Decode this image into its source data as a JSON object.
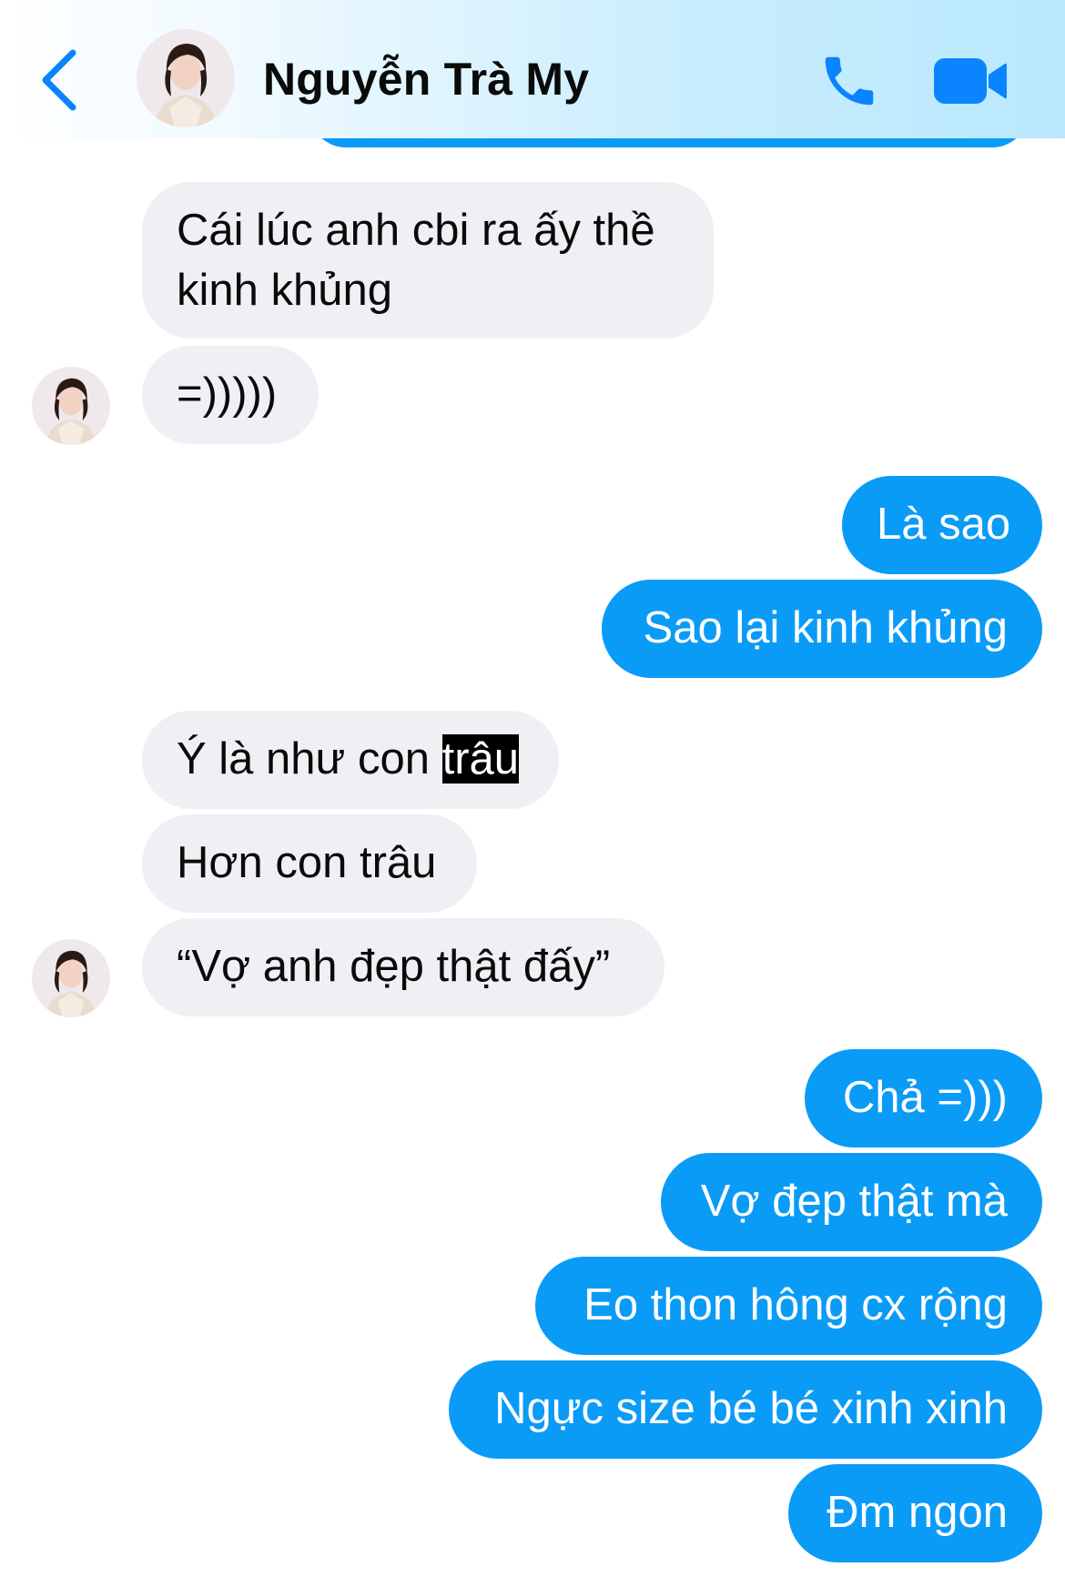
{
  "header": {
    "contact_name": "Nguyễn Trà My"
  },
  "colors": {
    "sent_bubble": "#0a9bf7",
    "received_bubble": "#f0f0f4",
    "accent": "#0a84ff"
  },
  "icons": {
    "back": "chevron-left-icon",
    "call": "phone-icon",
    "video": "video-camera-icon"
  },
  "messages": [
    {
      "side": "received",
      "lines": [
        "Cái lúc anh cbi ra ấy thề",
        "kinh khủng"
      ]
    },
    {
      "side": "received",
      "text": "=)))))"
    },
    {
      "side": "sent",
      "text": "Là sao"
    },
    {
      "side": "sent",
      "text": "Sao lại kinh khủng"
    },
    {
      "side": "received",
      "text_prefix": "Ý là như con ",
      "text_highlight": "trâu"
    },
    {
      "side": "received",
      "text": "Hơn con trâu"
    },
    {
      "side": "received",
      "text": "“Vợ anh đẹp thật đấy”"
    },
    {
      "side": "sent",
      "text": "Chả =)))"
    },
    {
      "side": "sent",
      "text": "Vợ đẹp thật mà"
    },
    {
      "side": "sent",
      "text": "Eo thon hông cx rộng"
    },
    {
      "side": "sent",
      "text": "Ngực size bé bé xinh xinh"
    },
    {
      "side": "sent",
      "text": "Đm ngon"
    }
  ]
}
